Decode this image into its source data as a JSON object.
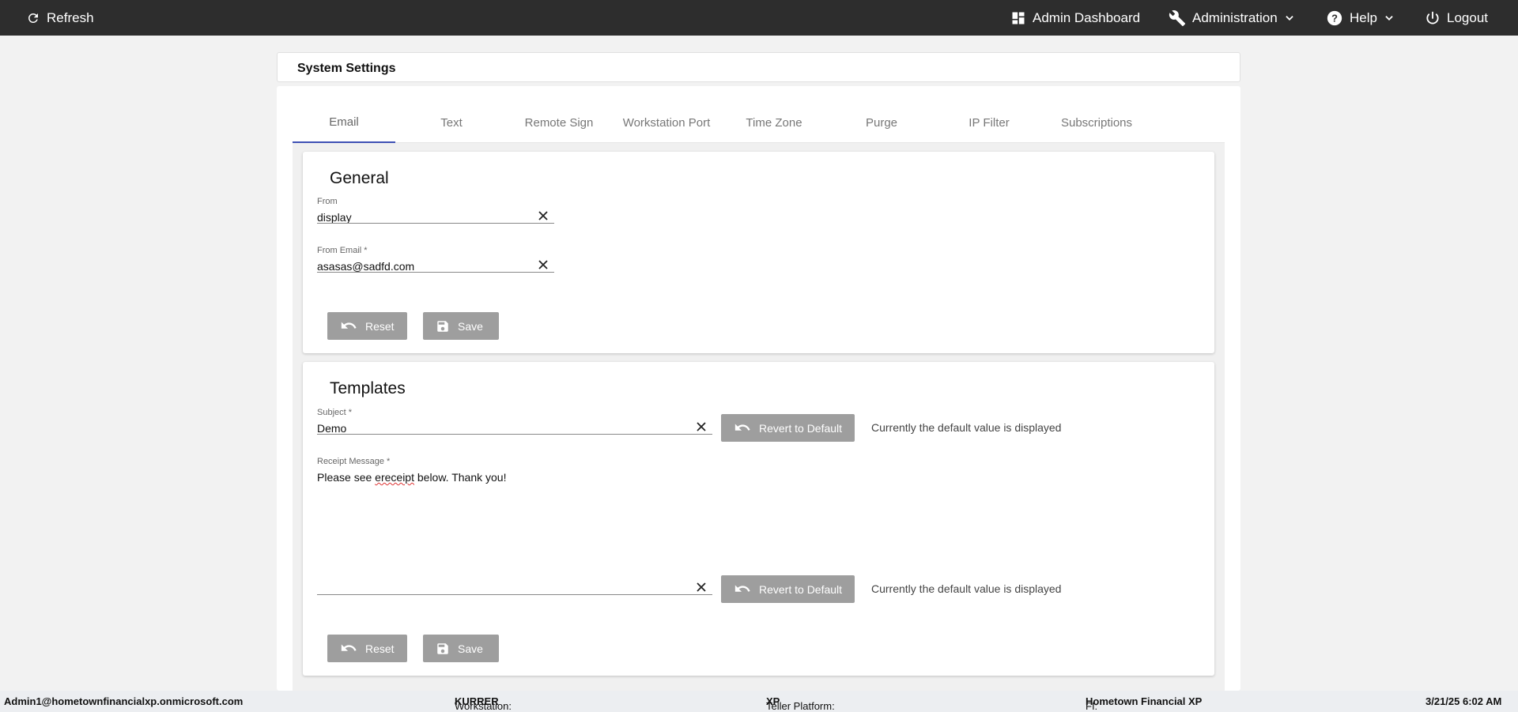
{
  "topbar": {
    "refresh_label": "Refresh",
    "admin_dashboard_label": "Admin Dashboard",
    "administration_label": "Administration",
    "help_label": "Help",
    "logout_label": "Logout"
  },
  "page": {
    "title": "System Settings"
  },
  "tabs": [
    {
      "label": "Email",
      "active": true
    },
    {
      "label": "Text"
    },
    {
      "label": "Remote Sign"
    },
    {
      "label": "Workstation Port"
    },
    {
      "label": "Time Zone"
    },
    {
      "label": "Purge"
    },
    {
      "label": "IP Filter"
    },
    {
      "label": "Subscriptions"
    }
  ],
  "general": {
    "title": "General",
    "from_label": "From",
    "from_value": "display",
    "from_email_label": "From Email *",
    "from_email_value": "asasas@sadfd.com",
    "reset_label": "Reset",
    "save_label": "Save"
  },
  "templates": {
    "title": "Templates",
    "subject_label": "Subject *",
    "subject_value": "Demo",
    "revert_label": "Revert to Default",
    "default_note": "Currently the default value is displayed",
    "receipt_label": "Receipt Message *",
    "receipt_value_1": "Please see ",
    "receipt_value_2": "ereceipt",
    "receipt_value_3": " below. Thank you!",
    "reset_label": "Reset",
    "save_label": "Save"
  },
  "footer": {
    "user": "Admin1@hometownfinancialxp.onmicrosoft.com",
    "workstation_label": "Workstation: ",
    "workstation_value": "KURRER",
    "teller_label": "Teller Platform: ",
    "teller_value": "XP",
    "fi_label": "FI: ",
    "fi_value": "Hometown Financial XP",
    "datetime": "3/21/25 6:02 AM"
  },
  "colors": {
    "topbar_bg": "#2d2d2d",
    "tab_indicator": "#3f51b5",
    "button_disabled": "#9e9e9e"
  }
}
